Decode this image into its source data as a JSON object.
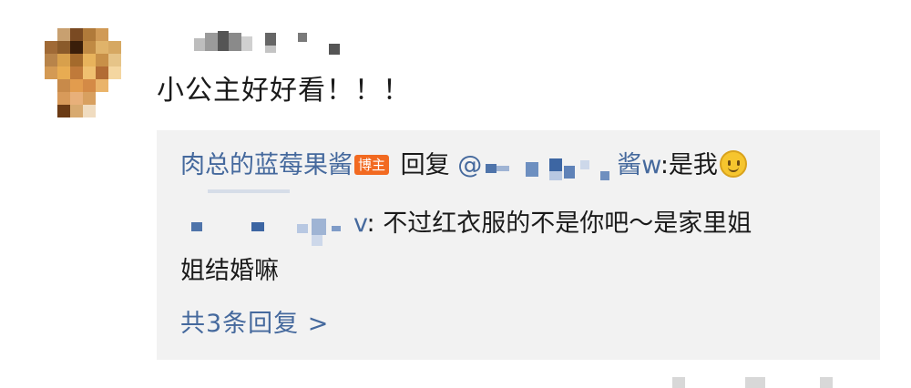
{
  "comment": {
    "text": "小公主好好看！！！"
  },
  "reply": {
    "author": "肉总的蓝莓果酱",
    "author_badge": "博主",
    "reply_word": "回复",
    "mention_prefix": "@",
    "mention_tail": "酱w",
    "text_part1": ":是我",
    "mention2_tail": "v",
    "text_part2": ": 不过红衣服的不是你吧～是家里姐",
    "text_part3": "姐结婚嘛",
    "emoji_icon": "smile-emoji-icon"
  },
  "replies_link": {
    "label": "共3条回复 >"
  },
  "colors": {
    "link": "#45699d",
    "badge": "#f26a21",
    "reply_bg": "#f2f2f2",
    "text": "#1a1a1a"
  }
}
